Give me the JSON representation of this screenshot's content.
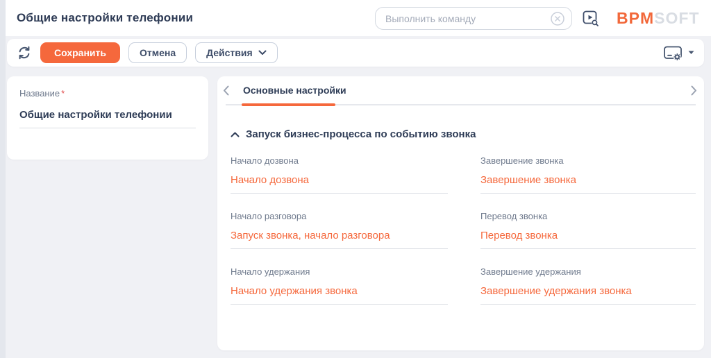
{
  "colors": {
    "accent_orange": "#F5683C",
    "title_navy": "#2E3B55",
    "label_gray": "#6E798C",
    "page_background": "#F0F1F5",
    "logo_soft_gray": "#D9DDE3"
  },
  "header": {
    "title": "Общие настройки телефонии",
    "command_bar": {
      "placeholder": "Выполнить команду",
      "clear_icon": "circle-x",
      "run_process_icon": "play-search"
    },
    "logo": {
      "part1": "BPM",
      "part2": "SOFT"
    }
  },
  "toolbar": {
    "refresh_icon": "refresh-arrows",
    "save_label": "Сохранить",
    "cancel_label": "Отмена",
    "actions_label": "Действия",
    "actions_chevron_icon": "chevron-down",
    "view_settings_icon": "display-gear",
    "view_settings_caret_icon": "caret-down"
  },
  "record_card": {
    "name_label": "Название",
    "required_marker": "*",
    "name_value": "Общие настройки телефонии"
  },
  "content": {
    "tabs": {
      "prev_icon": "chevron-left",
      "active": "Основные настройки",
      "next_icon": "chevron-right"
    },
    "section": {
      "collapse_icon": "chevron-up",
      "title": "Запуск бизнес-процесса по событию звонка",
      "fields": [
        {
          "label": "Начало дозвона",
          "value": "Начало дозвона"
        },
        {
          "label": "Завершение звонка",
          "value": "Завершение звонка"
        },
        {
          "label": "Начало разговора",
          "value": "Запуск звонка, начало разговора"
        },
        {
          "label": "Перевод звонка",
          "value": "Перевод звонка"
        },
        {
          "label": "Начало удержания",
          "value": "Начало удержания звонка"
        },
        {
          "label": "Завершение удержания",
          "value": "Завершение удержания звонка"
        }
      ]
    }
  }
}
